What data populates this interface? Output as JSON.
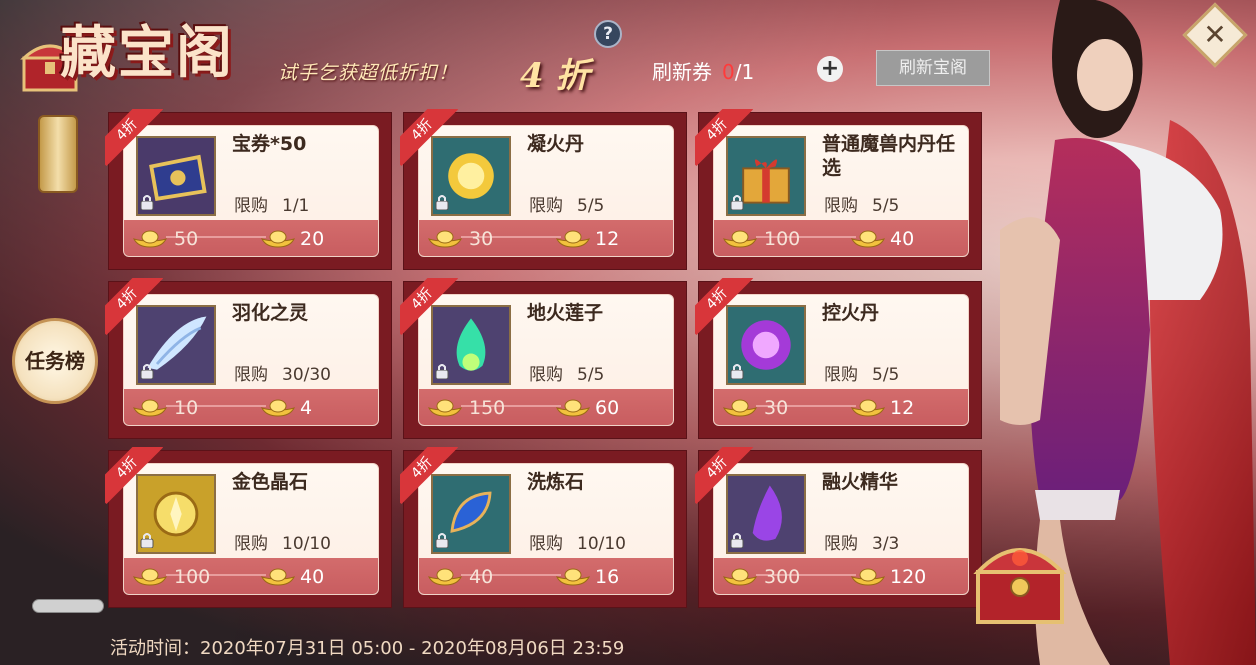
{
  "banner": {
    "title": "藏宝阁",
    "slogan": "试手乞获超低折扣！",
    "discount": "4 折"
  },
  "toolbar": {
    "help": "?",
    "refresh_ticket_label": "刷新券",
    "refresh_ticket_current": "0",
    "refresh_ticket_total": "/1",
    "add": "+",
    "refresh_button": "刷新宝阁",
    "close": "✕"
  },
  "side": {
    "task_tab": "任务榜"
  },
  "footer": {
    "activity_time": "活动时间：2020年07月31日 05:00 - 2020年08月06日 23:59"
  },
  "colors": {
    "ribbon": "#d8363a",
    "price_strip": "#c85d60",
    "ticket_current": "#ff3b3b"
  },
  "items": [
    {
      "badge": "4折",
      "name": "宝券*50",
      "limit_label": "限购",
      "limit": "1/1",
      "old_price": "50",
      "new_price": "20",
      "icon": "ticket-scroll-icon"
    },
    {
      "badge": "4折",
      "name": "凝火丹",
      "limit_label": "限购",
      "limit": "5/5",
      "old_price": "30",
      "new_price": "12",
      "icon": "golden-orb-icon"
    },
    {
      "badge": "4折",
      "name": "普通魔兽内丹任选",
      "limit_label": "限购",
      "limit": "5/5",
      "old_price": "100",
      "new_price": "40",
      "icon": "gift-box-icon"
    },
    {
      "badge": "4折",
      "name": "羽化之灵",
      "limit_label": "限购",
      "limit": "30/30",
      "old_price": "10",
      "new_price": "4",
      "icon": "feather-wing-icon"
    },
    {
      "badge": "4折",
      "name": "地火莲子",
      "limit_label": "限购",
      "limit": "5/5",
      "old_price": "150",
      "new_price": "60",
      "icon": "green-flame-icon"
    },
    {
      "badge": "4折",
      "name": "控火丹",
      "limit_label": "限购",
      "limit": "5/5",
      "old_price": "30",
      "new_price": "12",
      "icon": "purple-orb-icon"
    },
    {
      "badge": "4折",
      "name": "金色晶石",
      "limit_label": "限购",
      "limit": "10/10",
      "old_price": "100",
      "new_price": "40",
      "icon": "gold-crystal-icon"
    },
    {
      "badge": "4折",
      "name": "洗炼石",
      "limit_label": "限购",
      "limit": "10/10",
      "old_price": "40",
      "new_price": "16",
      "icon": "blue-stone-icon"
    },
    {
      "badge": "4折",
      "name": "融火精华",
      "limit_label": "限购",
      "limit": "3/3",
      "old_price": "300",
      "new_price": "120",
      "icon": "purple-flame-icon"
    }
  ]
}
